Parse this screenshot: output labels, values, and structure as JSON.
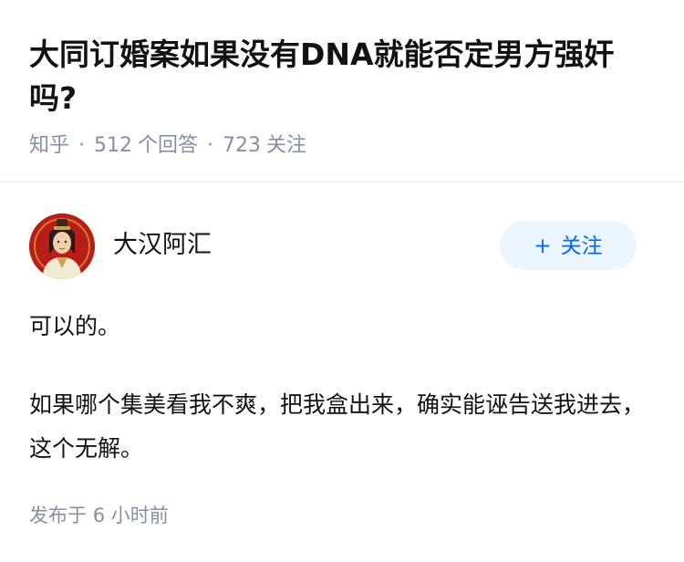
{
  "question": {
    "title": "大同订婚案如果没有DNA就能否定男方强奸吗?",
    "source": "知乎",
    "answer_count": "512",
    "answer_label": "个回答",
    "follower_count": "723",
    "follower_label": "关注"
  },
  "author": {
    "name": "大汉阿汇",
    "follow_icon": "+",
    "follow_label": "关注"
  },
  "answer": {
    "paragraphs": [
      "可以的。",
      "如果哪个集美看我不爽，把我盒出来，确实能诬告送我进去，这个无解。"
    ],
    "published_label": "发布于",
    "published_time": "6 小时前"
  },
  "colors": {
    "text": "#121212",
    "meta": "#8590a6",
    "accent": "#0066ff",
    "follow_bg": "#ebf5ff",
    "avatar_bg": "#b81d18"
  },
  "icons": {
    "avatar": "portrait-avatar",
    "follow": "plus-icon"
  }
}
